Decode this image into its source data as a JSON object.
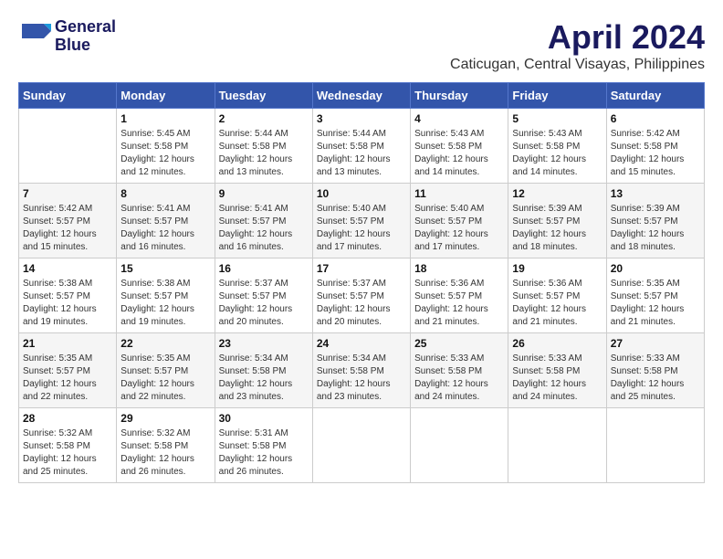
{
  "logo": {
    "line1": "General",
    "line2": "Blue"
  },
  "title": "April 2024",
  "location": "Caticugan, Central Visayas, Philippines",
  "weekdays": [
    "Sunday",
    "Monday",
    "Tuesday",
    "Wednesday",
    "Thursday",
    "Friday",
    "Saturday"
  ],
  "days": [
    {
      "date": "",
      "info": ""
    },
    {
      "date": "1",
      "sunrise": "5:45 AM",
      "sunset": "5:58 PM",
      "daylight": "12 hours and 12 minutes."
    },
    {
      "date": "2",
      "sunrise": "5:44 AM",
      "sunset": "5:58 PM",
      "daylight": "12 hours and 13 minutes."
    },
    {
      "date": "3",
      "sunrise": "5:44 AM",
      "sunset": "5:58 PM",
      "daylight": "12 hours and 13 minutes."
    },
    {
      "date": "4",
      "sunrise": "5:43 AM",
      "sunset": "5:58 PM",
      "daylight": "12 hours and 14 minutes."
    },
    {
      "date": "5",
      "sunrise": "5:43 AM",
      "sunset": "5:58 PM",
      "daylight": "12 hours and 14 minutes."
    },
    {
      "date": "6",
      "sunrise": "5:42 AM",
      "sunset": "5:58 PM",
      "daylight": "12 hours and 15 minutes."
    },
    {
      "date": "7",
      "sunrise": "5:42 AM",
      "sunset": "5:57 PM",
      "daylight": "12 hours and 15 minutes."
    },
    {
      "date": "8",
      "sunrise": "5:41 AM",
      "sunset": "5:57 PM",
      "daylight": "12 hours and 16 minutes."
    },
    {
      "date": "9",
      "sunrise": "5:41 AM",
      "sunset": "5:57 PM",
      "daylight": "12 hours and 16 minutes."
    },
    {
      "date": "10",
      "sunrise": "5:40 AM",
      "sunset": "5:57 PM",
      "daylight": "12 hours and 17 minutes."
    },
    {
      "date": "11",
      "sunrise": "5:40 AM",
      "sunset": "5:57 PM",
      "daylight": "12 hours and 17 minutes."
    },
    {
      "date": "12",
      "sunrise": "5:39 AM",
      "sunset": "5:57 PM",
      "daylight": "12 hours and 18 minutes."
    },
    {
      "date": "13",
      "sunrise": "5:39 AM",
      "sunset": "5:57 PM",
      "daylight": "12 hours and 18 minutes."
    },
    {
      "date": "14",
      "sunrise": "5:38 AM",
      "sunset": "5:57 PM",
      "daylight": "12 hours and 19 minutes."
    },
    {
      "date": "15",
      "sunrise": "5:38 AM",
      "sunset": "5:57 PM",
      "daylight": "12 hours and 19 minutes."
    },
    {
      "date": "16",
      "sunrise": "5:37 AM",
      "sunset": "5:57 PM",
      "daylight": "12 hours and 20 minutes."
    },
    {
      "date": "17",
      "sunrise": "5:37 AM",
      "sunset": "5:57 PM",
      "daylight": "12 hours and 20 minutes."
    },
    {
      "date": "18",
      "sunrise": "5:36 AM",
      "sunset": "5:57 PM",
      "daylight": "12 hours and 21 minutes."
    },
    {
      "date": "19",
      "sunrise": "5:36 AM",
      "sunset": "5:57 PM",
      "daylight": "12 hours and 21 minutes."
    },
    {
      "date": "20",
      "sunrise": "5:35 AM",
      "sunset": "5:57 PM",
      "daylight": "12 hours and 21 minutes."
    },
    {
      "date": "21",
      "sunrise": "5:35 AM",
      "sunset": "5:57 PM",
      "daylight": "12 hours and 22 minutes."
    },
    {
      "date": "22",
      "sunrise": "5:35 AM",
      "sunset": "5:57 PM",
      "daylight": "12 hours and 22 minutes."
    },
    {
      "date": "23",
      "sunrise": "5:34 AM",
      "sunset": "5:58 PM",
      "daylight": "12 hours and 23 minutes."
    },
    {
      "date": "24",
      "sunrise": "5:34 AM",
      "sunset": "5:58 PM",
      "daylight": "12 hours and 23 minutes."
    },
    {
      "date": "25",
      "sunrise": "5:33 AM",
      "sunset": "5:58 PM",
      "daylight": "12 hours and 24 minutes."
    },
    {
      "date": "26",
      "sunrise": "5:33 AM",
      "sunset": "5:58 PM",
      "daylight": "12 hours and 24 minutes."
    },
    {
      "date": "27",
      "sunrise": "5:33 AM",
      "sunset": "5:58 PM",
      "daylight": "12 hours and 25 minutes."
    },
    {
      "date": "28",
      "sunrise": "5:32 AM",
      "sunset": "5:58 PM",
      "daylight": "12 hours and 25 minutes."
    },
    {
      "date": "29",
      "sunrise": "5:32 AM",
      "sunset": "5:58 PM",
      "daylight": "12 hours and 26 minutes."
    },
    {
      "date": "30",
      "sunrise": "5:31 AM",
      "sunset": "5:58 PM",
      "daylight": "12 hours and 26 minutes."
    },
    {
      "date": "",
      "info": ""
    },
    {
      "date": "",
      "info": ""
    },
    {
      "date": "",
      "info": ""
    },
    {
      "date": "",
      "info": ""
    },
    {
      "date": "",
      "info": ""
    }
  ],
  "labels": {
    "sunrise": "Sunrise:",
    "sunset": "Sunset:",
    "daylight": "Daylight:"
  }
}
